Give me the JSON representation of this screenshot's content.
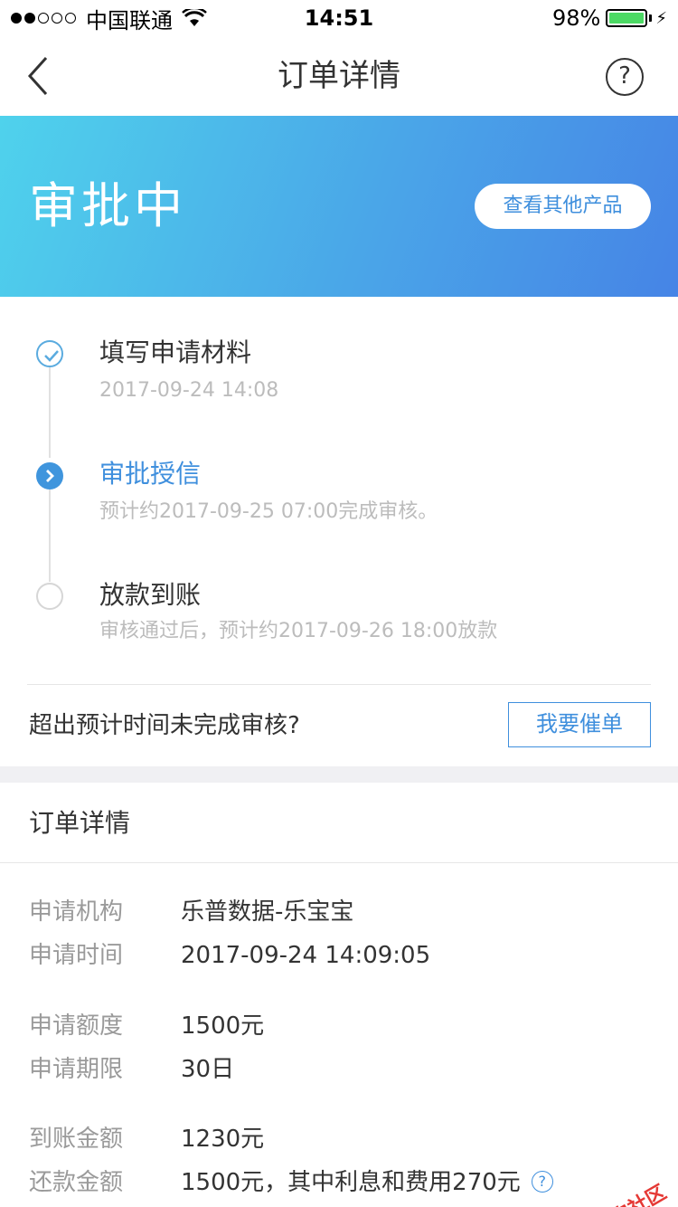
{
  "status_bar": {
    "carrier": "中国联通",
    "time": "14:51",
    "battery": "98%",
    "battery_level": 0.98
  },
  "nav": {
    "title": "订单详情"
  },
  "banner": {
    "status": "审批中",
    "other_products": "查看其他产品"
  },
  "timeline": [
    {
      "title": "填写申请材料",
      "sub": "2017-09-24 14:08",
      "state": "done"
    },
    {
      "title": "审批授信",
      "sub": "预计约2017-09-25 07:00完成审核。",
      "state": "current"
    },
    {
      "title": "放款到账",
      "sub": "审核通过后，预计约2017-09-26 18:00放款",
      "state": "pending"
    }
  ],
  "urge": {
    "text": "超出预计时间未完成审核?",
    "button": "我要催单"
  },
  "details": {
    "title": "订单详情",
    "rows": [
      {
        "label": "申请机构",
        "value": "乐普数据-乐宝宝"
      },
      {
        "label": "申请时间",
        "value": "2017-09-24 14:09:05"
      },
      {
        "label": "申请额度",
        "value": "1500元"
      },
      {
        "label": "申请期限",
        "value": "30日"
      },
      {
        "label": "到账金额",
        "value": "1230元"
      },
      {
        "label": "还款金额",
        "value": "1500元，其中利息和费用270元"
      }
    ]
  },
  "watermark": "卡农社区",
  "colors": {
    "accent": "#3f8fdd",
    "banner_start": "#4fd2ec",
    "banner_end": "#4684e6"
  }
}
